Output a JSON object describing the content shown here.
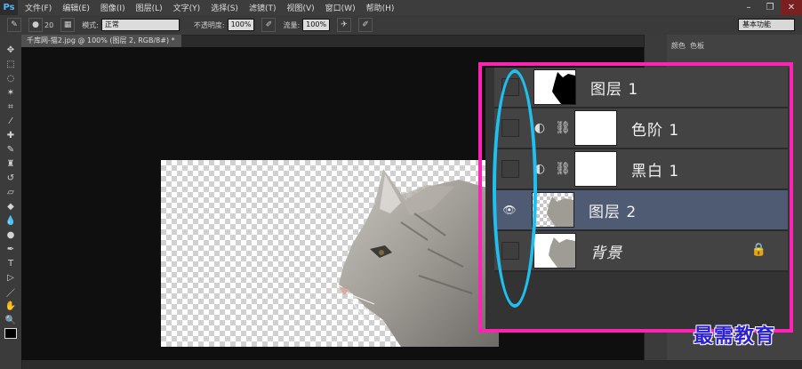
{
  "app": {
    "logo": "Ps"
  },
  "menu": [
    "文件(F)",
    "编辑(E)",
    "图像(I)",
    "图层(L)",
    "文字(Y)",
    "选择(S)",
    "滤镜(T)",
    "视图(V)",
    "窗口(W)",
    "帮助(H)"
  ],
  "window_controls": [
    "–",
    "❐",
    "✕"
  ],
  "options": {
    "mode_label": "模式:",
    "mode_value": "正常",
    "opacity_label": "不透明度:",
    "opacity_value": "100%",
    "flow_label": "流量:",
    "flow_value": "100%",
    "brush_size": "20",
    "workspace": "基本功能"
  },
  "document": {
    "tab_title": "千库网-猫2.jpg @ 100% (图层 2, RGB/8#) * ×"
  },
  "right_panel": {
    "tabs": [
      "颜色",
      "色板"
    ]
  },
  "layers": [
    {
      "name": "图层 1",
      "visible": false,
      "type": "mask-layer"
    },
    {
      "name": "色阶 1",
      "visible": false,
      "type": "adjustment"
    },
    {
      "name": "黑白 1",
      "visible": false,
      "type": "adjustment"
    },
    {
      "name": "图层 2",
      "visible": true,
      "type": "pixel",
      "selected": true
    },
    {
      "name": "背景",
      "visible": false,
      "type": "background",
      "locked": true
    }
  ],
  "icons": {
    "eye": "👁",
    "adjustment": "◐",
    "link": "⛓",
    "lock": "🔒"
  },
  "colors": {
    "highlight": "#ff22b4",
    "oval": "#1fc0ef",
    "selected_row": "#4f5a73"
  },
  "watermark": "最需教育"
}
